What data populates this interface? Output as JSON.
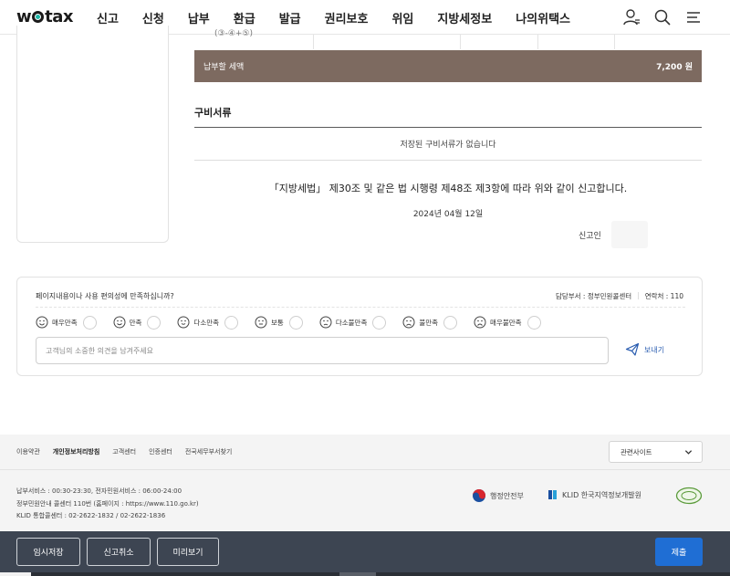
{
  "header": {
    "logo": "wetax",
    "logo_pre": "w",
    "logo_post": "tax",
    "nav": [
      "신고",
      "신청",
      "납부",
      "환급",
      "발급",
      "권리보호",
      "위임",
      "지방세정보",
      "나의위택스"
    ],
    "icons": [
      "user-icon",
      "search-icon",
      "menu-icon"
    ]
  },
  "table_fragment": "(③-④+⑤)",
  "tax_bar": {
    "label": "납부할 세액",
    "amount": "7,200 원",
    "color": "#7d6a60"
  },
  "documents": {
    "title": "구비서류",
    "empty_text": "저장된 구비서류가 없습니다"
  },
  "declaration": {
    "law_text": "「지방세법」 제30조 및 같은 법 시행령 제48조 제3항에 따라 위와 같이 신고합니다.",
    "date": "2024년 04월 12일",
    "reporter_label": "신고인"
  },
  "survey": {
    "question": "페이지내용이나 사용 편의성에 만족하십니까?",
    "dept": "담당부서 : 정부민원콜센터",
    "contact": "연락처 : 110",
    "ratings": [
      "매우만족",
      "만족",
      "다소만족",
      "보통",
      "다소불만족",
      "불만족",
      "매우불만족"
    ],
    "opinion_placeholder": "고객님의 소중한 의견을 남겨주세요",
    "send_label": "보내기"
  },
  "footer": {
    "links": [
      "이용약관",
      "개인정보처리방침",
      "고객센터",
      "인증센터",
      "전국세무부서찾기"
    ],
    "related_sites": "관련사이트",
    "info": [
      "납부서비스 : 00:30-23:30, 전자민원서비스 : 06:00-24:00",
      "정부민원안내 콜센터 110번 (홈페이지 : https://www.110.go.kr)",
      "KLID 통합콜센터 : 02-2622-1832 / 02-2622-1836"
    ],
    "partners": [
      "행정안전부",
      "KLID 한국지역정보개발원"
    ]
  },
  "actions": {
    "temp_save": "임시저장",
    "cancel": "신고취소",
    "preview": "미리보기",
    "submit": "제출"
  },
  "colors": {
    "accent": "#1f6ed4",
    "action_bar": "#3d4552",
    "brand_dot": "#1db5a6"
  }
}
